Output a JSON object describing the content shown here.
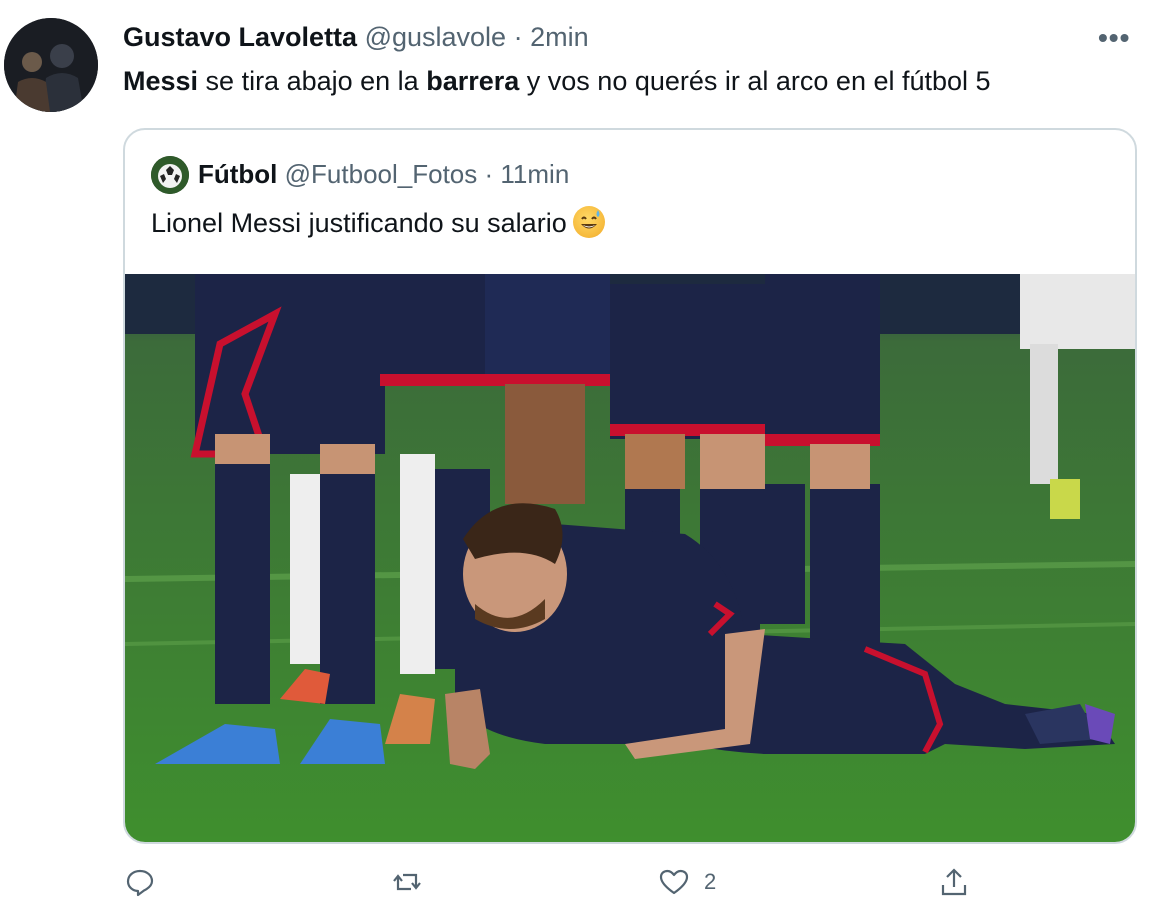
{
  "tweet": {
    "author_name": "Gustavo Lavoletta",
    "handle": "@guslavole",
    "separator": "·",
    "time": "2min",
    "text_parts": [
      {
        "t": "Messi",
        "bold": true
      },
      {
        "t": " se tira abajo en la ",
        "bold": false
      },
      {
        "t": "barrera",
        "bold": true
      },
      {
        "t": " y vos no querés ir al arco en el fútbol 5",
        "bold": false
      }
    ],
    "more_icon": "more-horizontal-icon"
  },
  "quote": {
    "author_name": "Fútbol",
    "handle": "@Futbool_Fotos",
    "separator": "·",
    "time": "11min",
    "text": "Lionel Messi justificando su salario",
    "emoji": "grinning-face-with-sweat-emoji"
  },
  "actions": {
    "reply_icon": "reply-icon",
    "retweet_icon": "retweet-icon",
    "like_icon": "heart-icon",
    "like_count": "2",
    "share_icon": "share-icon"
  },
  "colors": {
    "text": "#0f1419",
    "secondary": "#536471",
    "border": "#cfd9de",
    "pitch": "#3f8f2e",
    "kit_navy": "#1c2447",
    "kit_red": "#c8102e"
  }
}
